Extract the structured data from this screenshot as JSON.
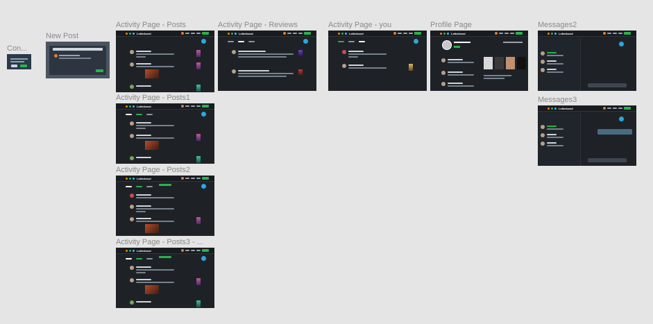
{
  "canvas": {
    "background": "#e5e5e5"
  },
  "frames": [
    {
      "key": "confirm",
      "label": "Con..."
    },
    {
      "key": "new_post",
      "label": "New Post"
    },
    {
      "key": "posts",
      "label": "Activity Page - Posts"
    },
    {
      "key": "reviews",
      "label": "Activity Page - Reviews"
    },
    {
      "key": "you",
      "label": "Activity Page - you"
    },
    {
      "key": "profile",
      "label": "Profile Page"
    },
    {
      "key": "messages2",
      "label": "Messages2"
    },
    {
      "key": "posts1",
      "label": "Activity Page - Posts1"
    },
    {
      "key": "messages3",
      "label": "Messages3"
    },
    {
      "key": "posts2",
      "label": "Activity Page - Posts2"
    },
    {
      "key": "posts3",
      "label": "Activity Page - Posts3 - ..."
    }
  ],
  "app": {
    "logo_text": "Letterboxd",
    "accent": "#2bb24c",
    "fab_color": "#2aa7e0"
  }
}
